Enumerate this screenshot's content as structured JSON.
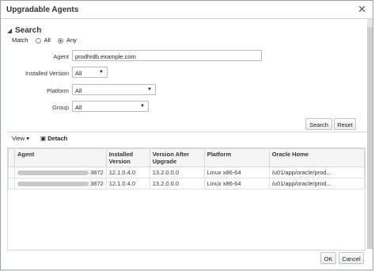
{
  "dialog": {
    "title": "Upgradable Agents",
    "close_glyph": "✕"
  },
  "search": {
    "header": "Search",
    "match_label": "Match",
    "match_all": "All",
    "match_any": "Any",
    "agent_label": "Agent",
    "agent_value": "prodhrdb.example.com",
    "installed_version_label": "Installed Version",
    "installed_version_value": "All",
    "platform_label": "Platform",
    "platform_value": "All",
    "group_label": "Group",
    "group_value": "All",
    "search_button": "Search",
    "reset_button": "Reset"
  },
  "toolbar": {
    "view_label": "View",
    "detach_label": "Detach"
  },
  "table": {
    "columns": [
      "Agent",
      "Installed Version",
      "Version After Upgrade",
      "Platform",
      "Oracle Home"
    ],
    "rows": [
      {
        "agent_suffix": "3872",
        "installed": "12.1.0.4.0",
        "after": "13.2.0.0.0",
        "platform": "Linux x86-64",
        "home": "/u01/app/oracle/prod..."
      },
      {
        "agent_suffix": "3872",
        "installed": "12.1.0.4.0",
        "after": "13.2.0.0.0",
        "platform": "Linux x86-64",
        "home": "/u01/app/oracle/prod..."
      }
    ]
  },
  "footer": {
    "ok_button": "OK",
    "cancel_button": "Cancel"
  }
}
